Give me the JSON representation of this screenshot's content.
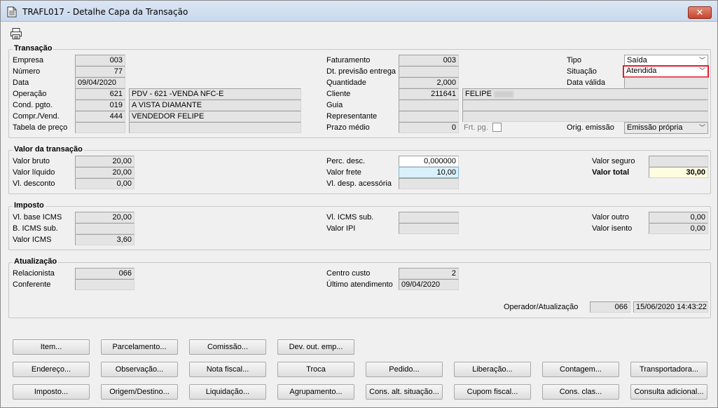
{
  "window": {
    "title": "TRAFL017 - Detalhe Capa da Transação",
    "close_label": "✕"
  },
  "transacao": {
    "title": "Transação",
    "empresa_label": "Empresa",
    "empresa": "003",
    "numero_label": "Número",
    "numero": "77",
    "data_label": "Data",
    "data": "09/04/2020",
    "operacao_label": "Operação",
    "operacao_cod": "621",
    "operacao_desc": "PDV - 621 -VENDA NFC-E",
    "cond_label": "Cond. pgto.",
    "cond_cod": "019",
    "cond_desc": "A VISTA DIAMANTE",
    "compr_label": "Compr./Vend.",
    "compr_cod": "444",
    "compr_desc": "VENDEDOR FELIPE",
    "tabela_label": "Tabela de preço",
    "tabela_cod": "",
    "tabela_desc": "",
    "faturamento_label": "Faturamento",
    "faturamento": "003",
    "dtprev_label": "Dt. previsão entrega",
    "dtprev": "",
    "quantidade_label": "Quantidade",
    "quantidade": "2,000",
    "cliente_label": "Cliente",
    "cliente_cod": "211641",
    "cliente_nome": "FELIPE",
    "guia_label": "Guia",
    "guia_cod": "",
    "guia_desc": "",
    "representante_label": "Representante",
    "representante_cod": "",
    "representante_desc": "",
    "prazo_label": "Prazo médio",
    "prazo": "0",
    "frtpg_label": "Frt. pg.",
    "tipo_label": "Tipo",
    "tipo": "Saída",
    "situacao_label": "Situação",
    "situacao": "Atendida",
    "datavalida_label": "Data válida",
    "datavalida": "",
    "origem_label": "Orig. emissão",
    "origem": "Emissão própria"
  },
  "valor": {
    "title": "Valor da transação",
    "bruto_label": "Valor bruto",
    "bruto": "20,00",
    "liquido_label": "Valor líquido",
    "liquido": "20,00",
    "desconto_label": "Vl. desconto",
    "desconto": "0,00",
    "percdesc_label": "Perc. desc.",
    "percdesc": "0,000000",
    "frete_label": "Valor frete",
    "frete": "10,00",
    "despacess_label": "Vl. desp. acessória",
    "despacess": "",
    "seguro_label": "Valor seguro",
    "seguro": "",
    "total_label": "Valor total",
    "total": "30,00"
  },
  "imposto": {
    "title": "Imposto",
    "baseicms_label": "Vl. base ICMS",
    "baseicms": "20,00",
    "bicmssub_label": "B. ICMS sub.",
    "bicmssub": "",
    "valoricms_label": "Valor ICMS",
    "valoricms": "3,60",
    "icmssub_label": "Vl. ICMS sub.",
    "icmssub": "",
    "ipi_label": "Valor IPI",
    "ipi": "",
    "outro_label": "Valor outro",
    "outro": "0,00",
    "isento_label": "Valor isento",
    "isento": "0,00"
  },
  "atualizacao": {
    "title": "Atualização",
    "relacionista_label": "Relacionista",
    "relacionista": "066",
    "conferente_label": "Conferente",
    "conferente": "",
    "centro_label": "Centro custo",
    "centro": "2",
    "ultimo_label": "Último atendimento",
    "ultimo": "09/04/2020",
    "operador_label": "Operador/Atualização",
    "operador": "066",
    "operador_data": "15/06/2020 14:43:22"
  },
  "buttons": {
    "row1": [
      "Item...",
      "Parcelamento...",
      "Comissão...",
      "Dev. out. emp..."
    ],
    "row2": [
      "Endereço...",
      "Observação...",
      "Nota fiscal...",
      "Troca",
      "Pedido...",
      "Liberação...",
      "Contagem...",
      "Transportadora..."
    ],
    "row3": [
      "Imposto...",
      "Origem/Destino...",
      "Liquidação...",
      "Agrupamento...",
      "Cons. alt. situação...",
      "Cupom fiscal...",
      "Cons. clas...",
      "Consulta adicional..."
    ]
  }
}
